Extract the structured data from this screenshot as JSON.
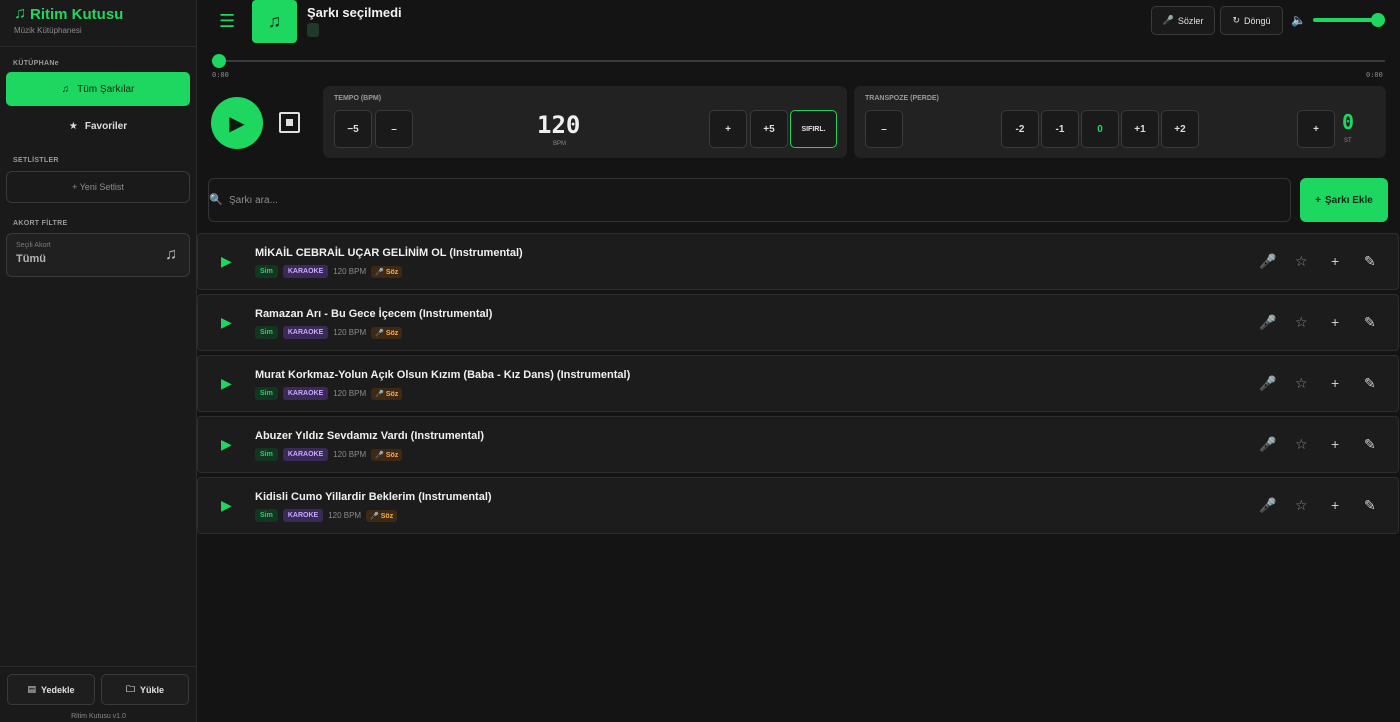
{
  "sidebar": {
    "brand_title": "Ritim Kutusu",
    "brand_subtitle": "Müzik Kütüphanesi",
    "library_label": "KÜTÜPHANe",
    "all_songs": "Tüm Şarkılar",
    "favorites": "Favoriler",
    "setlists_label": "SETLİSTLER",
    "new_setlist": "+ Yeni Setlist",
    "chord_filter_label": "AKORT FİLTRE",
    "selected_chord_label": "Seçili Akort",
    "selected_chord_value": "Tümü",
    "backup_button": "Yedekle",
    "load_button": "Yükle",
    "version": "Ritim Kutusu v1.0"
  },
  "player": {
    "current_song": "Şarkı seçilmedi",
    "lyrics_button": "Sözler",
    "loop_button": "Döngü",
    "time_current": "0:00",
    "time_total": "0:00",
    "progress": 0,
    "volume": 0.9
  },
  "tempo": {
    "label": "TEMPO (BPM)",
    "minus5": "−5",
    "minus1": "–",
    "value": "120",
    "unit": "BPM",
    "plus1": "+",
    "plus5": "+5",
    "reset": "SIFIRL."
  },
  "transpose": {
    "label": "TRANSPOZE (PERDE)",
    "minus": "–",
    "presets": [
      "-2",
      "-1",
      "0",
      "+1",
      "+2"
    ],
    "plus": "+",
    "value": "0",
    "unit": "ST"
  },
  "search": {
    "placeholder": "Şarkı ara...",
    "add_button": "Şarkı Ekle"
  },
  "songs": [
    {
      "title": "MİKAİL CEBRAİL UÇAR GELİNİM OL (Instrumental)",
      "tag1": "Sim",
      "tag2": "KARAOKE",
      "bpm": "120 BPM",
      "lyrics": "Söz"
    },
    {
      "title": "Ramazan Arı - Bu Gece İçecem (Instrumental)",
      "tag1": "Sim",
      "tag2": "KARAOKE",
      "bpm": "120 BPM",
      "lyrics": "Söz"
    },
    {
      "title": "Murat Korkmaz-Yolun Açık Olsun Kızım (Baba - Kız Dans) (Instrumental)",
      "tag1": "Sim",
      "tag2": "KARAOKE",
      "bpm": "120 BPM",
      "lyrics": "Söz"
    },
    {
      "title": "Abuzer Yıldız Sevdamız Vardı (Instrumental)",
      "tag1": "Sim",
      "tag2": "KARAOKE",
      "bpm": "120 BPM",
      "lyrics": "Söz"
    },
    {
      "title": "Kidisli Cumo Yillardir Beklerim (Instrumental)",
      "tag1": "Sim",
      "tag2": "KAROKE",
      "bpm": "120 BPM",
      "lyrics": "Söz"
    }
  ],
  "colors": {
    "accent": "#1ed760",
    "background": "#141414",
    "sidebar": "#1a1a1a",
    "panel": "#222222"
  },
  "icons": {
    "brand": "music-note-icon",
    "menu": "hamburger-icon",
    "lyrics": "microphone-icon",
    "loop": "loop-icon",
    "volume": "speaker-icon",
    "play": "play-icon",
    "stop": "stop-icon",
    "search": "search-icon",
    "favorite": "star-icon",
    "add": "plus-icon",
    "edit": "pencil-icon"
  }
}
